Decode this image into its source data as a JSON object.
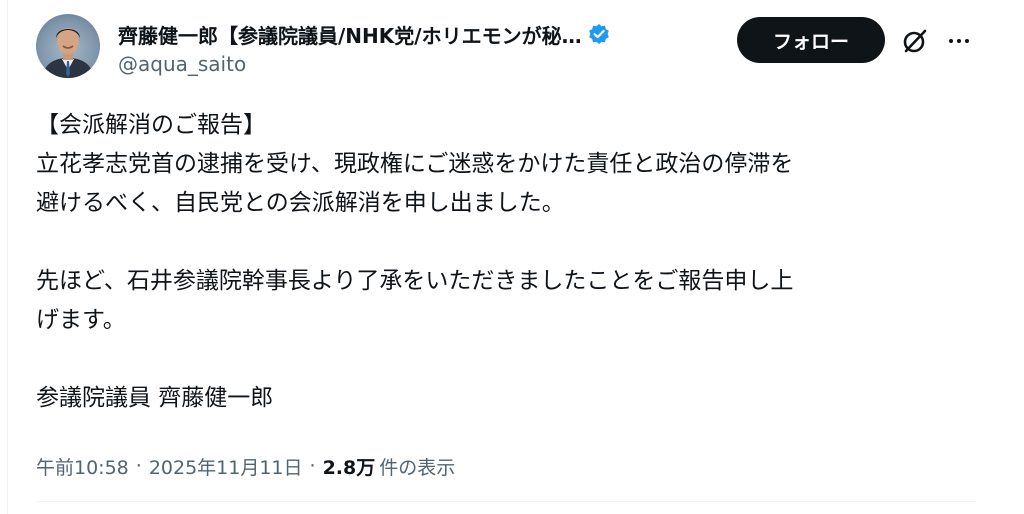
{
  "author": {
    "display_name": "齊藤健一郎【参議院議員/NHK党/ホリエモンが秘…",
    "handle": "@aqua_saito",
    "verified": true
  },
  "actions": {
    "follow_label": "フォロー",
    "grok_icon": "grok-slash-icon",
    "more_icon": "more-dots-icon"
  },
  "post": {
    "text": "【会派解消のご報告】\n立花孝志党首の逮捕を受け、現政権にご迷惑をかけた責任と政治の停滞を\n避けるべく、自民党との会派解消を申し出ました。\n\n先ほど、石井参議院幹事長より了承をいただきましたことをご報告申し上\nげます。\n\n参議院議員 齊藤健一郎"
  },
  "meta": {
    "time": "午前10:58",
    "separator": "·",
    "date": "2025年11月11日",
    "views_count": "2.8万",
    "views_label": "件の表示"
  },
  "colors": {
    "text_primary": "#0f1419",
    "text_secondary": "#536471",
    "verified_blue": "#1d9bf0",
    "follow_bg": "#0f1419"
  }
}
